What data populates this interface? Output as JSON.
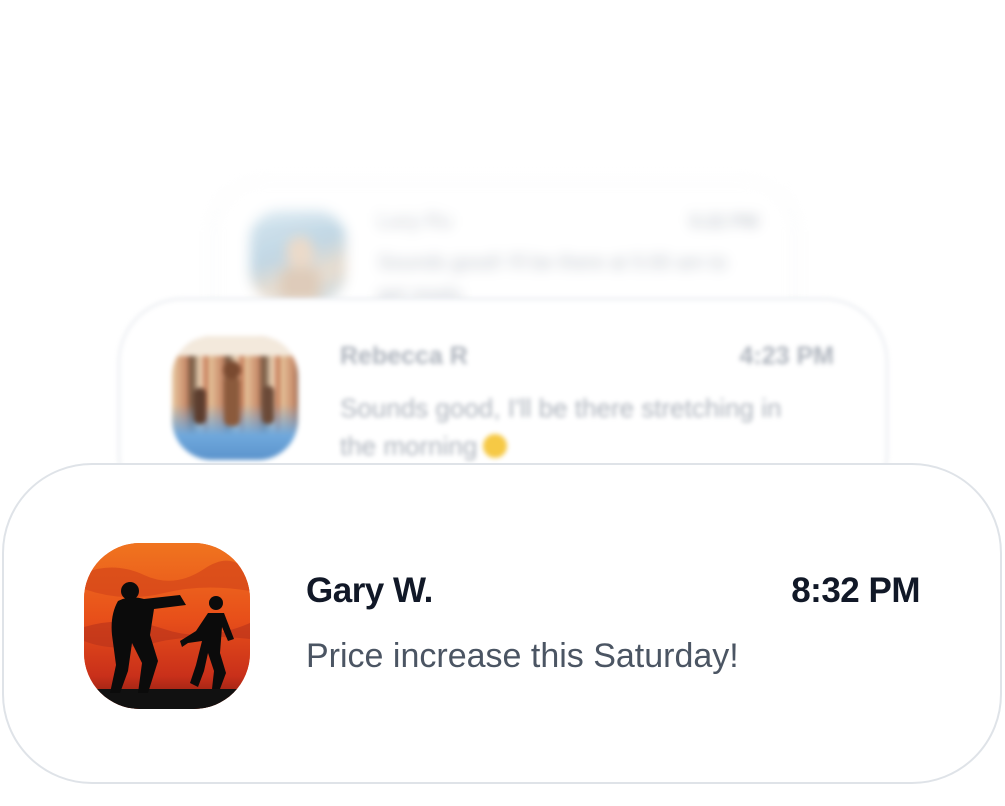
{
  "notifications": [
    {
      "name": "Lucy Ru",
      "time": "5:22 PM",
      "message": "Sounds good! I'll be there at 5:00 am to get ready."
    },
    {
      "name": "Rebecca R",
      "time": "4:23 PM",
      "message": "Sounds good, I'll be there stretching in the morning",
      "emoji_icon": "sun-emoji-icon"
    },
    {
      "name": "Gary W.",
      "time": "8:32 PM",
      "message": "Price increase this Saturday!"
    }
  ],
  "colors": {
    "front_title": "#111827",
    "front_message": "#4b5563",
    "card_border": "#dfe3e8",
    "avatar_sunset": "#e35a1c",
    "background": "#ffffff"
  }
}
